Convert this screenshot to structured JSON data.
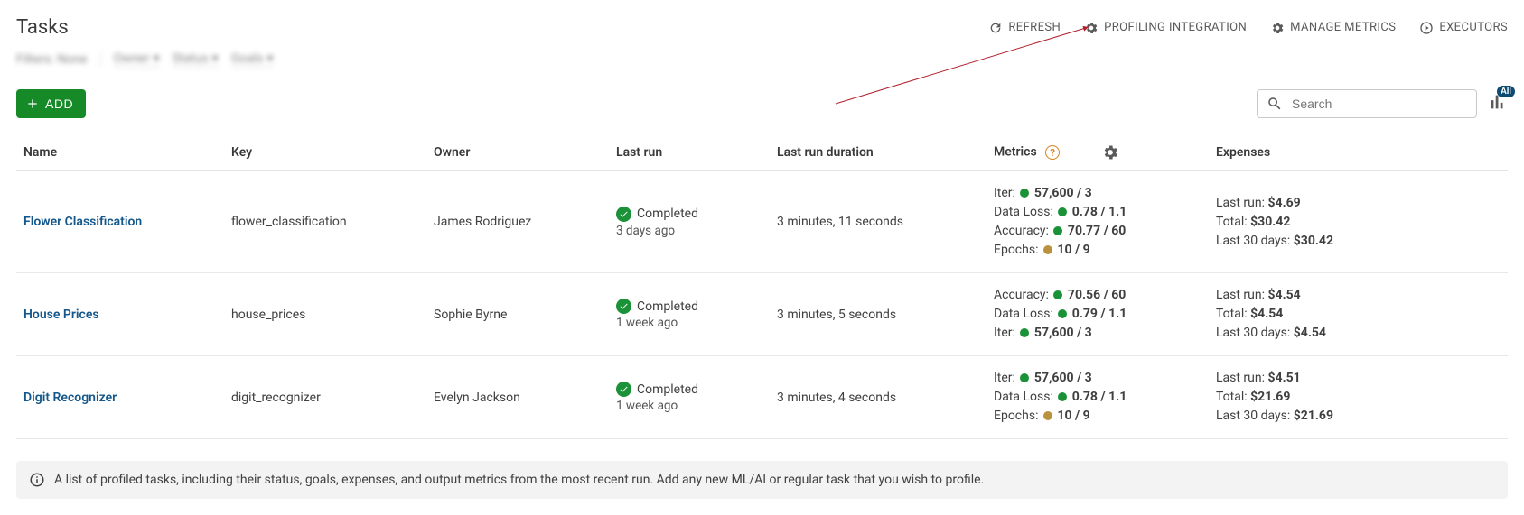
{
  "page_title": "Tasks",
  "toolbar": {
    "refresh": "REFRESH",
    "profiling": "PROFILING INTEGRATION",
    "manage_metrics": "MANAGE METRICS",
    "executors": "EXECUTORS"
  },
  "filters": {
    "label": "Filters:",
    "none": "None",
    "owner": "Owner",
    "status": "Status",
    "goals": "Goals"
  },
  "add_button": "ADD",
  "search_placeholder": "Search",
  "all_badge": "All",
  "columns": {
    "name": "Name",
    "key": "Key",
    "owner": "Owner",
    "last_run": "Last run",
    "duration": "Last run duration",
    "metrics": "Metrics",
    "expenses": "Expenses"
  },
  "status_completed": "Completed",
  "exp_labels": {
    "last_run": "Last run:",
    "total": "Total:",
    "last30": "Last 30 days:"
  },
  "rows": [
    {
      "name": "Flower Classification",
      "key": "flower_classification",
      "owner": "James Rodriguez",
      "last_run_rel": "3 days ago",
      "duration": "3 minutes, 11 seconds",
      "metrics": [
        {
          "label": "Iter:",
          "dot": "green",
          "value": "57,600 / 3"
        },
        {
          "label": "Data Loss:",
          "dot": "green",
          "value": "0.78 / 1.1"
        },
        {
          "label": "Accuracy:",
          "dot": "green",
          "value": "70.77 / 60"
        },
        {
          "label": "Epochs:",
          "dot": "gold",
          "value": "10 / 9"
        }
      ],
      "expenses": {
        "last_run": "$4.69",
        "total": "$30.42",
        "last30": "$30.42"
      }
    },
    {
      "name": "House Prices",
      "key": "house_prices",
      "owner": "Sophie Byrne",
      "last_run_rel": "1 week ago",
      "duration": "3 minutes, 5 seconds",
      "metrics": [
        {
          "label": "Accuracy:",
          "dot": "green",
          "value": "70.56 / 60"
        },
        {
          "label": "Data Loss:",
          "dot": "green",
          "value": "0.79 / 1.1"
        },
        {
          "label": "Iter:",
          "dot": "green",
          "value": "57,600 / 3"
        }
      ],
      "expenses": {
        "last_run": "$4.54",
        "total": "$4.54",
        "last30": "$4.54"
      }
    },
    {
      "name": "Digit Recognizer",
      "key": "digit_recognizer",
      "owner": "Evelyn Jackson",
      "last_run_rel": "1 week ago",
      "duration": "3 minutes, 4 seconds",
      "metrics": [
        {
          "label": "Iter:",
          "dot": "green",
          "value": "57,600 / 3"
        },
        {
          "label": "Data Loss:",
          "dot": "green",
          "value": "0.78 / 1.1"
        },
        {
          "label": "Epochs:",
          "dot": "gold",
          "value": "10 / 9"
        }
      ],
      "expenses": {
        "last_run": "$4.51",
        "total": "$21.69",
        "last30": "$21.69"
      }
    }
  ],
  "info_bar": "A list of profiled tasks, including their status, goals, expenses, and output metrics from the most recent run. Add any new ML/AI or regular task that you wish to profile."
}
